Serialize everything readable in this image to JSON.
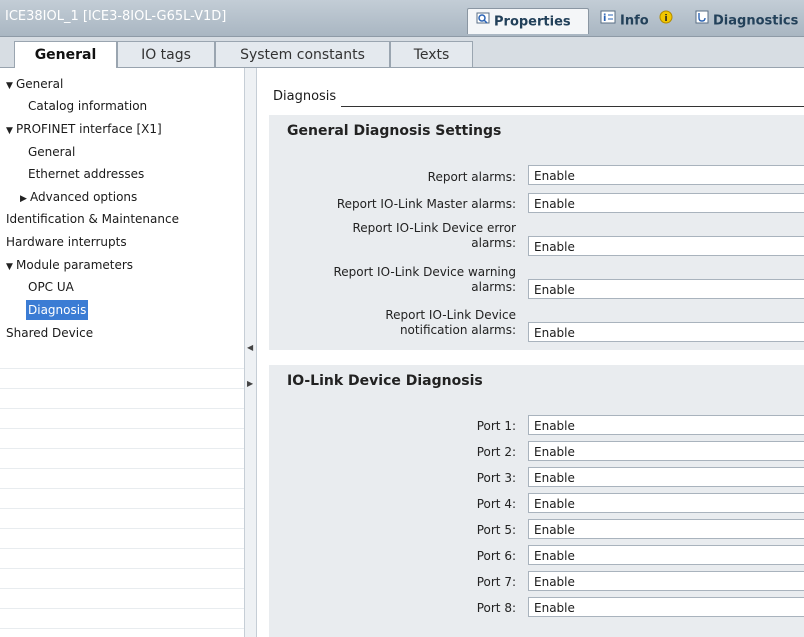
{
  "titlebar": {
    "title": "ICE38IOL_1 [ICE3-8IOL-G65L-V1D]",
    "properties_tab": "Properties",
    "info_tab": "Info",
    "diagnostics_tab": "Diagnostics"
  },
  "tabs": [
    "General",
    "IO tags",
    "System constants",
    "Texts"
  ],
  "sidebar": {
    "general": "General",
    "catalog_info": "Catalog information",
    "profinet": "PROFINET interface [X1]",
    "profinet_general": "General",
    "ethernet": "Ethernet addresses",
    "advanced": "Advanced options",
    "identification": "Identification & Maintenance",
    "hardware_interrupts": "Hardware interrupts",
    "module_params": "Module parameters",
    "opc_ua": "OPC UA",
    "diagnosis": "Diagnosis",
    "shared_device": "Shared Device"
  },
  "content": {
    "heading": "Diagnosis",
    "general_section": {
      "title": "General Diagnosis Settings",
      "fields": [
        {
          "label1": "",
          "label2": "Report alarms:",
          "value": "Enable"
        },
        {
          "label1": "",
          "label2": "Report IO-Link Master alarms:",
          "value": "Enable"
        },
        {
          "label1": "Report IO-Link Device error",
          "label2": "alarms:",
          "value": "Enable"
        },
        {
          "label1": "Report IO-Link Device warning",
          "label2": "alarms:",
          "value": "Enable"
        },
        {
          "label1": "Report IO-Link Device",
          "label2": "notification alarms:",
          "value": "Enable"
        }
      ]
    },
    "iolink_section": {
      "title": "IO-Link Device Diagnosis",
      "ports": [
        {
          "label": "Port 1:",
          "value": "Enable"
        },
        {
          "label": "Port 2:",
          "value": "Enable"
        },
        {
          "label": "Port 3:",
          "value": "Enable"
        },
        {
          "label": "Port 4:",
          "value": "Enable"
        },
        {
          "label": "Port 5:",
          "value": "Enable"
        },
        {
          "label": "Port 6:",
          "value": "Enable"
        },
        {
          "label": "Port 7:",
          "value": "Enable"
        },
        {
          "label": "Port 8:",
          "value": "Enable"
        }
      ]
    }
  },
  "colors": {
    "selection": "#3b7cd4",
    "section_bg": "#e9ecef",
    "titlebar": "#b4c0cb"
  }
}
